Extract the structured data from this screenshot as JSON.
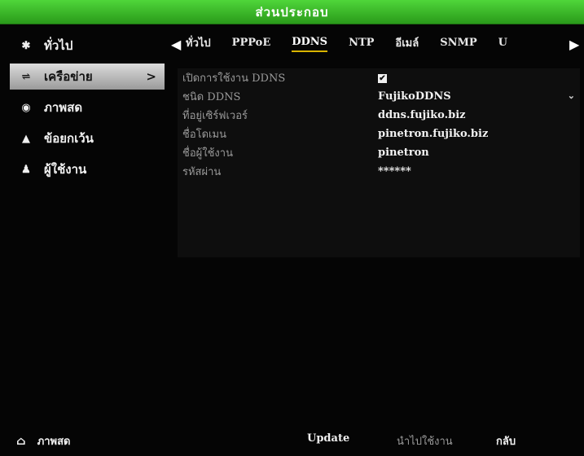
{
  "window": {
    "title": "ส่วนประกอบ"
  },
  "sidebar": {
    "items": [
      {
        "label": "ทั่วไป",
        "icon": "gear-icon"
      },
      {
        "label": "เครือข่าย",
        "icon": "network-icon",
        "active": true,
        "chevron": ">"
      },
      {
        "label": "ภาพสด",
        "icon": "eye-icon"
      },
      {
        "label": "ข้อยกเว้น",
        "icon": "warning-icon"
      },
      {
        "label": "ผู้ใช้งาน",
        "icon": "users-icon"
      }
    ]
  },
  "tabs": {
    "items": [
      "ทั่วไป",
      "PPPoE",
      "DDNS",
      "NTP",
      "อีเมล์",
      "SNMP",
      "U"
    ],
    "active": "DDNS"
  },
  "form": {
    "rows": [
      {
        "label": "เปิดการใช้งาน DDNS",
        "value": "",
        "checked": true
      },
      {
        "label": "ชนิด DDNS",
        "value": "FujikoDDNS"
      },
      {
        "label": "ที่อยู่เซิร์ฟเวอร์",
        "value": "ddns.fujiko.biz"
      },
      {
        "label": "ชื่อโดเมน",
        "value": "pinetron.fujiko.biz"
      },
      {
        "label": "ชื่อผู้ใช้งาน",
        "value": "pinetron"
      },
      {
        "label": "รหัสผ่าน",
        "value": "******"
      }
    ]
  },
  "footer": {
    "home_label": "ภาพสด",
    "update_label": "Update",
    "apply_label": "นำไปใช้งาน",
    "back_label": "กลับ"
  }
}
